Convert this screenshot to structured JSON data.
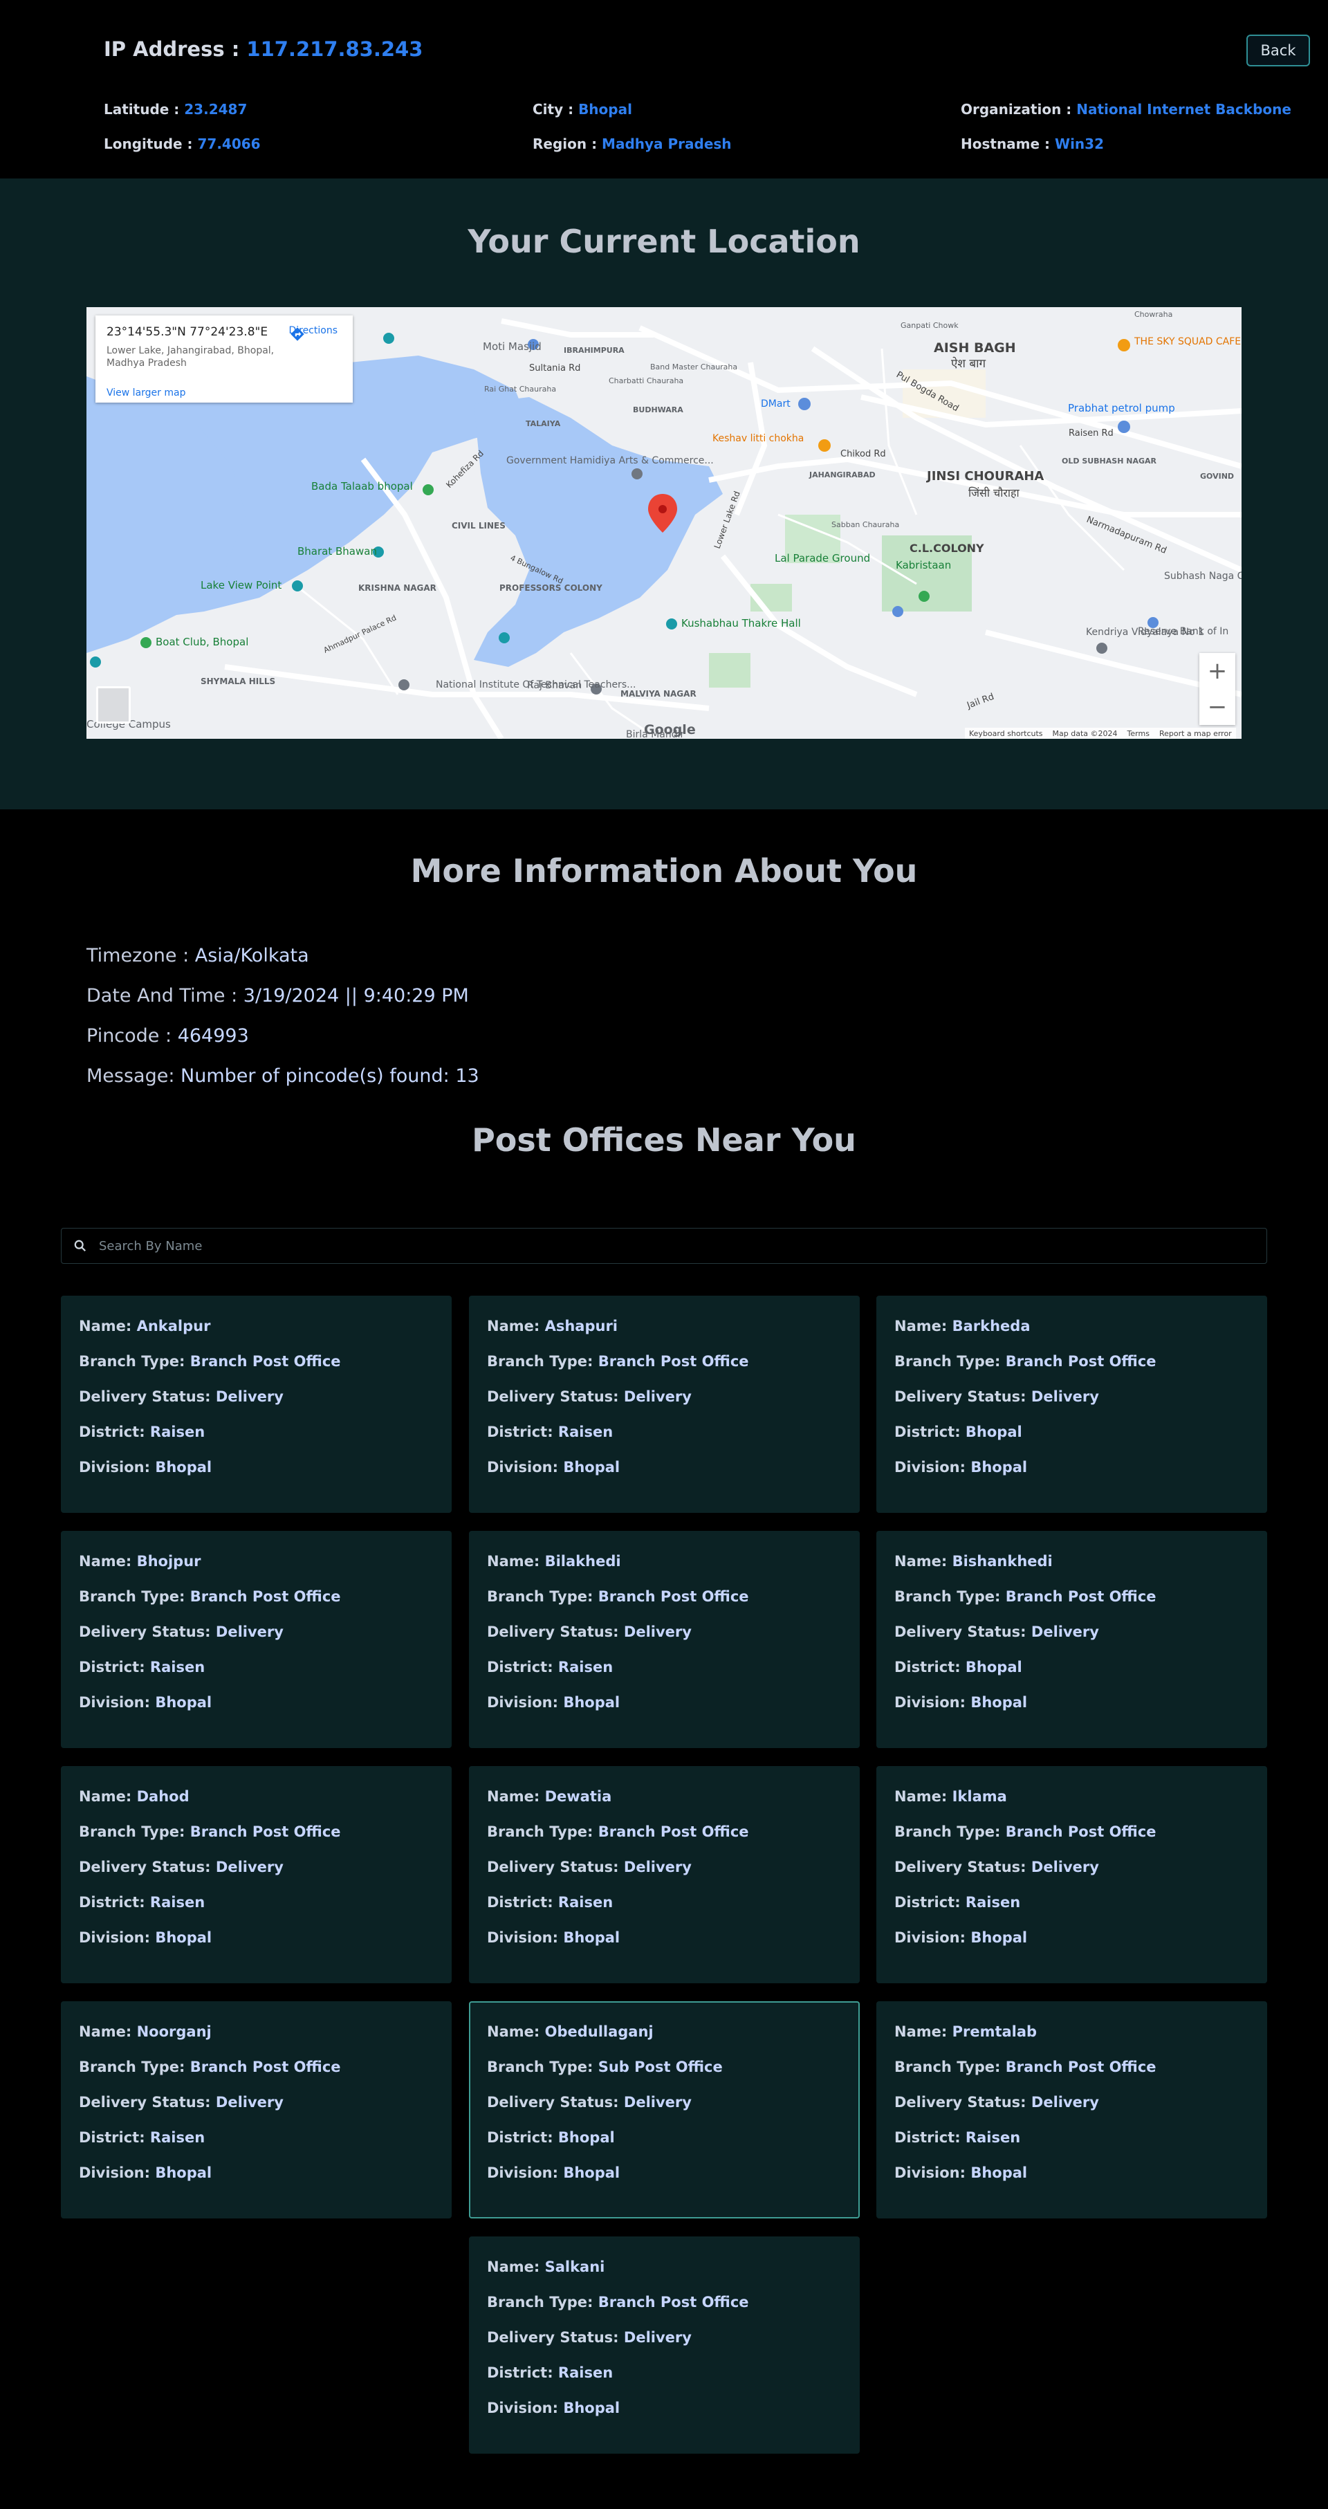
{
  "header": {
    "ip_label": "IP Address : ",
    "ip_value": "117.217.83.243",
    "back_label": "Back",
    "latitude_label": "Latitude : ",
    "latitude_value": "23.2487",
    "longitude_label": "Longitude : ",
    "longitude_value": "77.4066",
    "city_label": "City : ",
    "city_value": "Bhopal",
    "region_label": "Region : ",
    "region_value": "Madhya Pradesh",
    "org_label": "Organization : ",
    "org_value": "National Internet Backbone",
    "hostname_label": "Hostname : ",
    "hostname_value": "Win32"
  },
  "location": {
    "title": "Your Current Location",
    "map": {
      "coord": "23°14'55.3\"N 77°24'23.8\"E",
      "address": "Lower Lake, Jahangirabad, Bhopal, Madhya Pradesh",
      "directions": "Directions",
      "view_larger": "View larger map",
      "zoom_in": "+",
      "zoom_out": "−",
      "google": "Google",
      "footer": [
        "Keyboard shortcuts",
        "Map data ©2024",
        "Terms",
        "Report a map error"
      ],
      "place_labels": [
        "AISH BAGH",
        "ऐश बाग",
        "JINSI CHOURAHA",
        "जिंसी चौराहा",
        "C.L.COLONY",
        "Lal Parade Ground",
        "Kabristaan",
        "Kushabhau Thakre Hall",
        "Keshav litti chokha",
        "DMart",
        "Prabhat petrol pump",
        "THE SKY SQUAD CAFE AND LOUNGE",
        "Bada Talaab bhopal",
        "Bharat Bhawan",
        "Lake View Point",
        "Boat Club, Bhopal",
        "Moti Masjid",
        "Sultania Rd",
        "Government Hamidiya Arts & Commerce...",
        "CIVIL LINES",
        "KRISHNA NAGAR",
        "PROFESSORS COLONY",
        "SHYMALA HILLS",
        "National Institute Of Technical Teachers...",
        "Raj Bhavan",
        "MALVIYA NAGAR",
        "Kendriya Vidyalaya No 1",
        "Reserve Bank of In",
        "Subhash Naga Chauraha",
        "OLD SUBHASH NAGAR",
        "College Campus",
        "Birla Mandir",
        "Raisen Rd",
        "Narmadapuram Rd",
        "Pul Bogda Road",
        "Jail Rd",
        "Lower Lake Rd",
        "Kohefiza Rd",
        "Chikod Rd",
        "JAHANGIRABAD",
        "BUDHWARA",
        "TALAIYA",
        "IBRAHIMPURA",
        "Sabban Chauraha",
        "Band Master Chauraha",
        "Charbatti Chauraha",
        "Rai Ghat Chauraha",
        "4 Bungalow Rd",
        "Ahmadpur Palace Rd",
        "Ganpati Chowk",
        "Chowraha",
        "GOVIND"
      ]
    }
  },
  "more": {
    "title": "More Information About You",
    "timezone_label": "Timezone : ",
    "timezone_value": "Asia/Kolkata",
    "datetime_label": "Date And Time : ",
    "datetime_value": "3/19/2024 || 9:40:29 PM",
    "pincode_label": "Pincode : ",
    "pincode_value": "464993",
    "message_label": "Message: ",
    "message_value": "Number of pincode(s) found: 13"
  },
  "post": {
    "title": "Post Offices Near You",
    "search_placeholder": "Search By Name",
    "field_labels": {
      "name": "Name: ",
      "branch": "Branch Type: ",
      "delivery": "Delivery Status: ",
      "district": "District: ",
      "division": "Division: "
    },
    "offices": [
      {
        "name": "Ankalpur",
        "branch": "Branch Post Office",
        "delivery": "Delivery",
        "district": "Raisen",
        "division": "Bhopal"
      },
      {
        "name": "Ashapuri",
        "branch": "Branch Post Office",
        "delivery": "Delivery",
        "district": "Raisen",
        "division": "Bhopal"
      },
      {
        "name": "Barkheda",
        "branch": "Branch Post Office",
        "delivery": "Delivery",
        "district": "Bhopal",
        "division": "Bhopal"
      },
      {
        "name": "Bhojpur",
        "branch": "Branch Post Office",
        "delivery": "Delivery",
        "district": "Raisen",
        "division": "Bhopal"
      },
      {
        "name": "Bilakhedi",
        "branch": "Branch Post Office",
        "delivery": "Delivery",
        "district": "Raisen",
        "division": "Bhopal"
      },
      {
        "name": "Bishankhedi",
        "branch": "Branch Post Office",
        "delivery": "Delivery",
        "district": "Bhopal",
        "division": "Bhopal"
      },
      {
        "name": "Dahod",
        "branch": "Branch Post Office",
        "delivery": "Delivery",
        "district": "Raisen",
        "division": "Bhopal"
      },
      {
        "name": "Dewatia",
        "branch": "Branch Post Office",
        "delivery": "Delivery",
        "district": "Raisen",
        "division": "Bhopal"
      },
      {
        "name": "Iklama",
        "branch": "Branch Post Office",
        "delivery": "Delivery",
        "district": "Raisen",
        "division": "Bhopal"
      },
      {
        "name": "Noorganj",
        "branch": "Branch Post Office",
        "delivery": "Delivery",
        "district": "Raisen",
        "division": "Bhopal"
      },
      {
        "name": "Obedullaganj",
        "branch": "Sub Post Office",
        "delivery": "Delivery",
        "district": "Bhopal",
        "division": "Bhopal"
      },
      {
        "name": "Premtalab",
        "branch": "Branch Post Office",
        "delivery": "Delivery",
        "district": "Raisen",
        "division": "Bhopal"
      },
      {
        "name": "Salkani",
        "branch": "Branch Post Office",
        "delivery": "Delivery",
        "district": "Raisen",
        "division": "Bhopal"
      }
    ]
  }
}
